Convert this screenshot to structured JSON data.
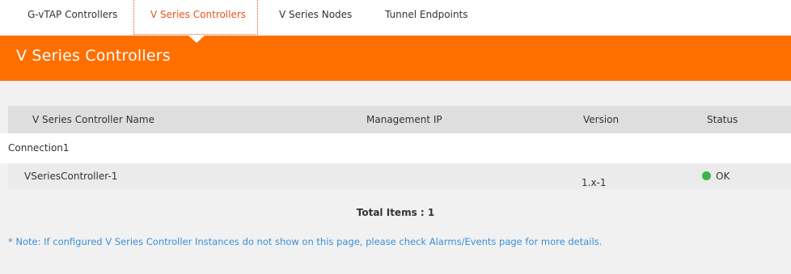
{
  "tabs": [
    {
      "label": "G-vTAP Controllers",
      "active": false
    },
    {
      "label": "V Series Controllers",
      "active": true
    },
    {
      "label": "V Series Nodes",
      "active": false
    },
    {
      "label": "Tunnel Endpoints",
      "active": false
    }
  ],
  "banner": {
    "title": "V Series Controllers"
  },
  "table": {
    "columns": [
      "V Series Controller Name",
      "Management IP",
      "Version",
      "Status"
    ],
    "groups": [
      {
        "label": "Connection1",
        "rows": [
          {
            "name": "VSeriesController-1",
            "management_ip": "",
            "version": "1.x-1",
            "status": "OK"
          }
        ]
      }
    ]
  },
  "footer": {
    "total_items": "Total Items : 1",
    "note": "* Note: If configured V Series Controller Instances do not show on this page, please check Alarms/Events page for more details."
  },
  "colors": {
    "accent": "#ff6f00",
    "active_tab": "#e8531a",
    "status_ok": "#3fb549",
    "note_text": "#3a8fd9"
  }
}
